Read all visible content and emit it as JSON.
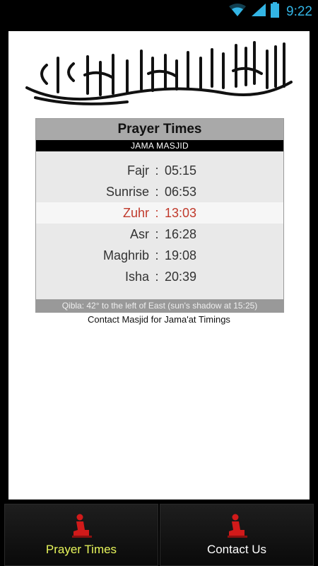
{
  "status_bar": {
    "time": "9:22",
    "icons": [
      "wifi-icon",
      "signal-icon",
      "battery-icon"
    ],
    "accent_color": "#33b5e5"
  },
  "header": {
    "calligraphy_text": "لا إله إلا الله محمد رسول الله"
  },
  "prayer_box": {
    "title": "Prayer Times",
    "masjid": "JAMA MASJID",
    "prayers": [
      {
        "name": "Fajr",
        "time": "05:15"
      },
      {
        "name": "Sunrise",
        "time": "06:53"
      },
      {
        "name": "Zuhr",
        "time": "13:03"
      },
      {
        "name": "Asr",
        "time": "16:28"
      },
      {
        "name": "Maghrib",
        "time": "19:08"
      },
      {
        "name": "Isha",
        "time": "20:39"
      }
    ],
    "separator": ":",
    "current_color": "#c0392b",
    "qibla": "Qibla: 42° to the left of East (sun's shadow at 15:25)"
  },
  "contact_note": "Contact Masjid for Jama'at Timings",
  "tabs": [
    {
      "label": "Prayer Times",
      "icon": "praying-person-icon",
      "color": "#e8f65b"
    },
    {
      "label": "Contact Us",
      "icon": "praying-person-icon",
      "color": "#ffffff"
    }
  ]
}
